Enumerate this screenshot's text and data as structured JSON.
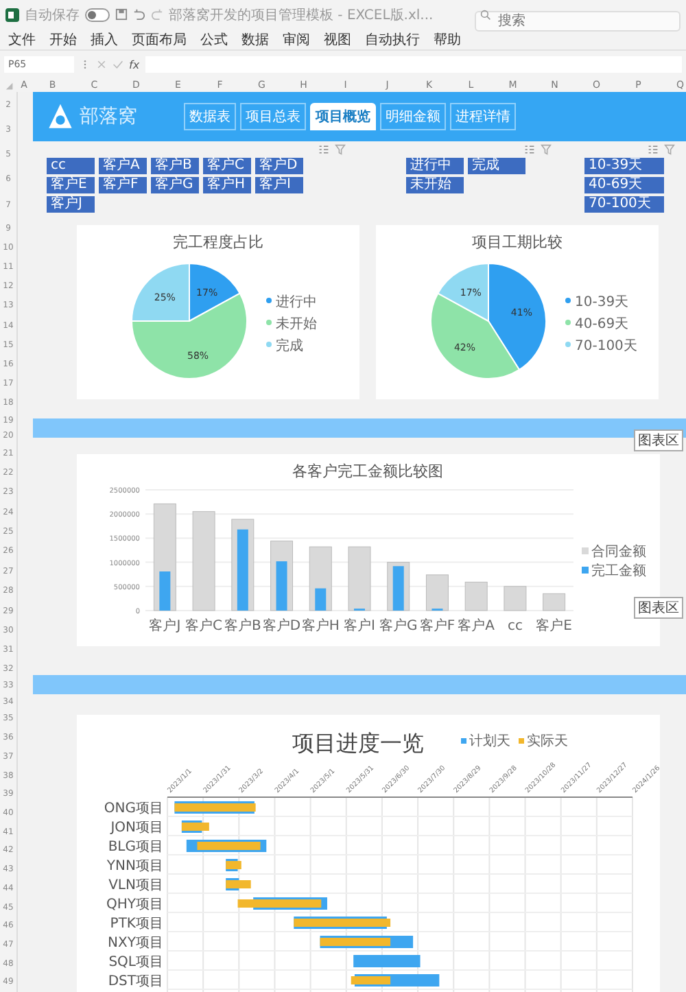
{
  "window": {
    "title": "部落窝开发的项目管理模板 - EXCEL版.xl...",
    "autosave_label": "自动保存",
    "autosave": false,
    "search": {
      "placeholder": "搜索"
    }
  },
  "menu": [
    "文件",
    "开始",
    "插入",
    "页面布局",
    "公式",
    "数据",
    "审阅",
    "视图",
    "自动执行",
    "帮助"
  ],
  "formula_bar": {
    "name_box": "P65",
    "fx": "fx"
  },
  "columns": [
    "A",
    "B",
    "C",
    "D",
    "E",
    "F",
    "G",
    "H",
    "I",
    "J",
    "K",
    "L",
    "M",
    "N",
    "O",
    "P",
    "Q"
  ],
  "banner": {
    "row_numbers": [
      "2",
      "3"
    ],
    "logo": "部落窝",
    "nav": [
      {
        "label": "数据表",
        "selected": false
      },
      {
        "label": "项目总表",
        "selected": false
      },
      {
        "label": "项目概览",
        "selected": true
      },
      {
        "label": "明细金额",
        "selected": false
      },
      {
        "label": "进程详情",
        "selected": false
      }
    ]
  },
  "slicers": {
    "row_numbers": [
      "5",
      "6",
      "7"
    ],
    "groups": [
      {
        "items": [
          "cc",
          "客户A",
          "客户B",
          "客户C",
          "客户D",
          "客户E",
          "客户F",
          "客户G",
          "客户H",
          "客户I",
          "客户J"
        ]
      },
      {
        "items": [
          "进行中",
          "完成",
          "未开始"
        ]
      },
      {
        "items": [
          "10-39天",
          "40-69天",
          "70-100天"
        ]
      }
    ]
  },
  "pies": {
    "row_numbers": [
      "9",
      "10",
      "11",
      "12",
      "13",
      "14",
      "15",
      "16",
      "17",
      "18"
    ],
    "charts": [
      {
        "chart_data": {
          "type": "pie",
          "title": "完工程度占比",
          "categories": [
            "进行中",
            "未开始",
            "完成"
          ],
          "values": [
            17,
            58,
            25
          ],
          "value_labels": [
            "17%",
            "58%",
            "25%"
          ],
          "legend": "right"
        }
      },
      {
        "chart_data": {
          "type": "pie",
          "title": "项目工期比较",
          "categories": [
            "10-39天",
            "40-69天",
            "70-100天"
          ],
          "values": [
            41,
            42,
            17
          ],
          "value_labels": [
            "41%",
            "42%",
            "17%"
          ],
          "legend": "right"
        }
      }
    ]
  },
  "strip_1": {
    "row_numbers": [
      "19",
      "20"
    ],
    "tip": "图表区"
  },
  "bar_chart": {
    "row_numbers": [
      "21",
      "22",
      "23",
      "24",
      "25",
      "26",
      "27",
      "28",
      "29",
      "30",
      "31"
    ],
    "tip": "图表区",
    "chart_data": {
      "type": "bar",
      "title": "各客户完工金额比较图",
      "categories": [
        "客户J",
        "客户C",
        "客户B",
        "客户D",
        "客户H",
        "客户I",
        "客户G",
        "客户F",
        "客户A",
        "cc",
        "客户E"
      ],
      "series": [
        {
          "name": "合同金额",
          "color": "#d9d9d9",
          "values": [
            2210000,
            2050000,
            1890000,
            1440000,
            1320000,
            1320000,
            1000000,
            740000,
            590000,
            500000,
            350000
          ]
        },
        {
          "name": "完工金额",
          "color": "#3ea6f0",
          "values": [
            810000,
            0,
            1680000,
            1020000,
            460000,
            40000,
            920000,
            40000,
            0,
            0,
            0
          ]
        }
      ],
      "ylim": [
        0,
        2500000
      ],
      "yticks": [
        0,
        500000,
        1000000,
        1500000,
        2000000,
        2500000
      ],
      "grid": true,
      "legend": "right"
    }
  },
  "strip_2": {
    "row_numbers": [
      "32",
      "33",
      "34"
    ]
  },
  "gantt": {
    "row_numbers": [
      "35",
      "36",
      "37",
      "38",
      "39",
      "40",
      "41",
      "42",
      "43",
      "44",
      "45",
      "46",
      "47",
      "48",
      "49"
    ],
    "title": "项目进度一览",
    "legend": [
      {
        "name": "计划天",
        "color": "#3ea6f0"
      },
      {
        "name": "实际天",
        "color": "#f2b72c"
      }
    ],
    "date_labels": [
      "2023/1/1",
      "2023/1/31",
      "2023/3/2",
      "2023/4/1",
      "2023/5/1",
      "2023/5/31",
      "2023/6/30",
      "2023/7/30",
      "2023/8/29",
      "2023/9/28",
      "2023/10/28",
      "2023/11/27",
      "2023/12/27",
      "2024/1/26"
    ],
    "tasks": [
      "ONG项目",
      "JON项目",
      "BLG项目",
      "YNN项目",
      "VLN项目",
      "QHY项目",
      "PTK项目",
      "NXY项目",
      "SQL项目",
      "DST项目"
    ]
  }
}
